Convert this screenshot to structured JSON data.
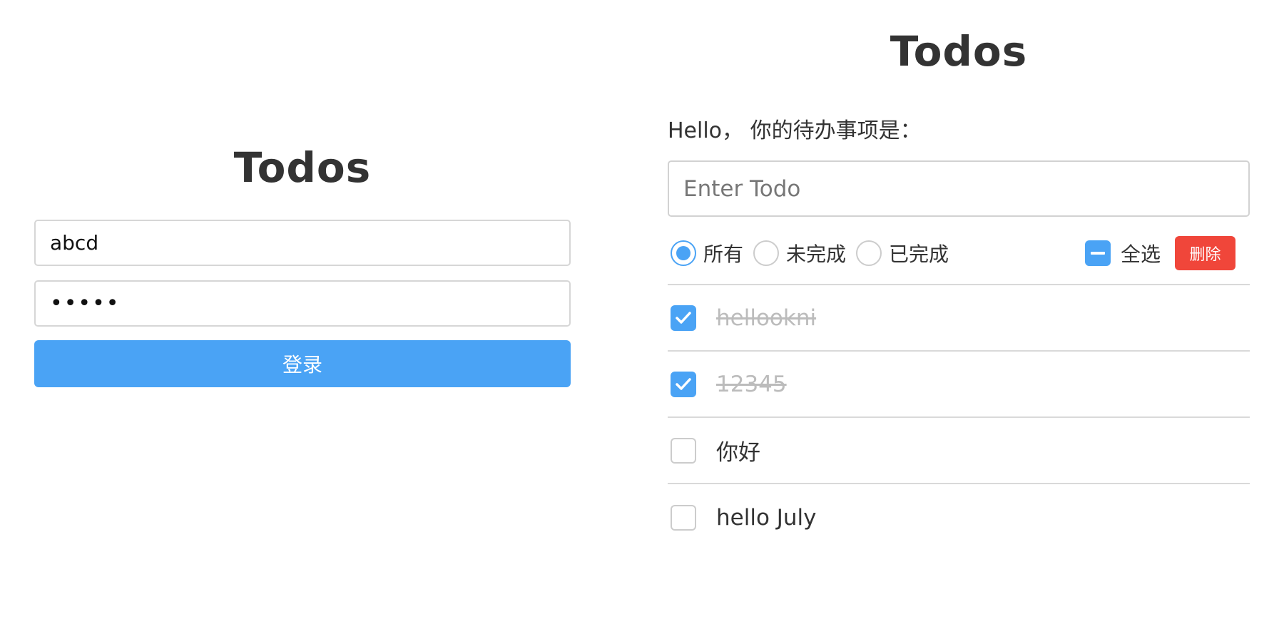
{
  "login": {
    "title": "Todos",
    "username_value": "abcd",
    "password_value": "•••••",
    "submit_label": "登录"
  },
  "todos": {
    "title": "Todos",
    "greeting": "Hello， 你的待办事项是：",
    "input_placeholder": "Enter Todo",
    "filters": [
      {
        "label": "所有",
        "checked": true
      },
      {
        "label": "未完成",
        "checked": false
      },
      {
        "label": "已完成",
        "checked": false
      }
    ],
    "select_all_label": "全选",
    "delete_label": "删除",
    "items": [
      {
        "text": "hellookni",
        "done": true
      },
      {
        "text": "12345",
        "done": true
      },
      {
        "text": "你好",
        "done": false
      },
      {
        "text": "hello July",
        "done": false
      }
    ]
  },
  "colors": {
    "accent": "#4aa3f5",
    "danger": "#f0463a",
    "done_text": "#bcbcbc"
  }
}
